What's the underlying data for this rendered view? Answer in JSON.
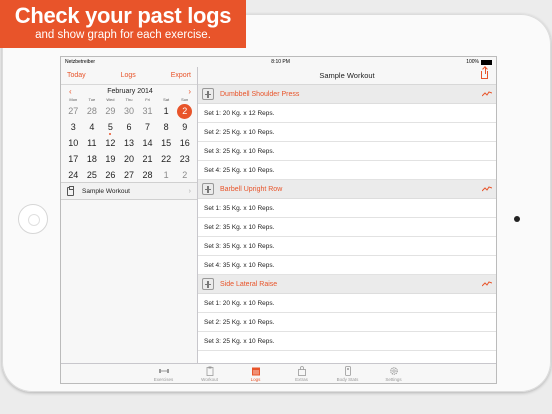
{
  "banner": {
    "headline": "Check your past logs",
    "subline": "and show graph for each exercise."
  },
  "status": {
    "carrier": "Netzbetreiber",
    "time": "8:10 PM",
    "battery": "100%"
  },
  "left_nav": {
    "today": "Today",
    "logs": "Logs",
    "export": "Export"
  },
  "calendar": {
    "month": "February 2014",
    "weekdays": [
      "Mon",
      "Tue",
      "Wed",
      "Thu",
      "Fri",
      "Sat",
      "Sun"
    ],
    "weeks": [
      [
        "27",
        "28",
        "29",
        "30",
        "31",
        "1",
        "2"
      ],
      [
        "3",
        "4",
        "5",
        "6",
        "7",
        "8",
        "9"
      ],
      [
        "10",
        "11",
        "12",
        "13",
        "14",
        "15",
        "16"
      ],
      [
        "17",
        "18",
        "19",
        "20",
        "21",
        "22",
        "23"
      ],
      [
        "24",
        "25",
        "26",
        "27",
        "28",
        "1",
        "2"
      ]
    ],
    "selected_day": "2"
  },
  "workout_list": {
    "item": "Sample Workout"
  },
  "right_nav": {
    "title": "Sample Workout"
  },
  "exercises": [
    {
      "name": "Dumbbell Shoulder Press",
      "sets": [
        "Set  1: 20 Kg. x 12 Reps.",
        "Set  2: 25 Kg. x 10 Reps.",
        "Set  3: 25 Kg. x 10 Reps.",
        "Set  4: 25 Kg. x 10 Reps."
      ]
    },
    {
      "name": "Barbell Upright Row",
      "sets": [
        "Set  1: 35 Kg. x 10 Reps.",
        "Set  2: 35 Kg. x 10 Reps.",
        "Set  3: 35 Kg. x 10 Reps.",
        "Set  4: 35 Kg. x 10 Reps."
      ]
    },
    {
      "name": "Side Lateral Raise",
      "sets": [
        "Set  1: 20 Kg. x 10 Reps.",
        "Set  2: 25 Kg. x 10 Reps.",
        "Set  3: 25 Kg. x 10 Reps."
      ]
    }
  ],
  "tabs": [
    {
      "label": "Exercises",
      "icon": "dumbbell-icon"
    },
    {
      "label": "Workout",
      "icon": "clipboard-icon"
    },
    {
      "label": "Logs",
      "icon": "calendar-icon"
    },
    {
      "label": "Extras",
      "icon": "bag-icon"
    },
    {
      "label": "Body Stats",
      "icon": "scale-icon"
    },
    {
      "label": "Settings",
      "icon": "gear-icon"
    }
  ],
  "colors": {
    "accent": "#e8542a"
  }
}
